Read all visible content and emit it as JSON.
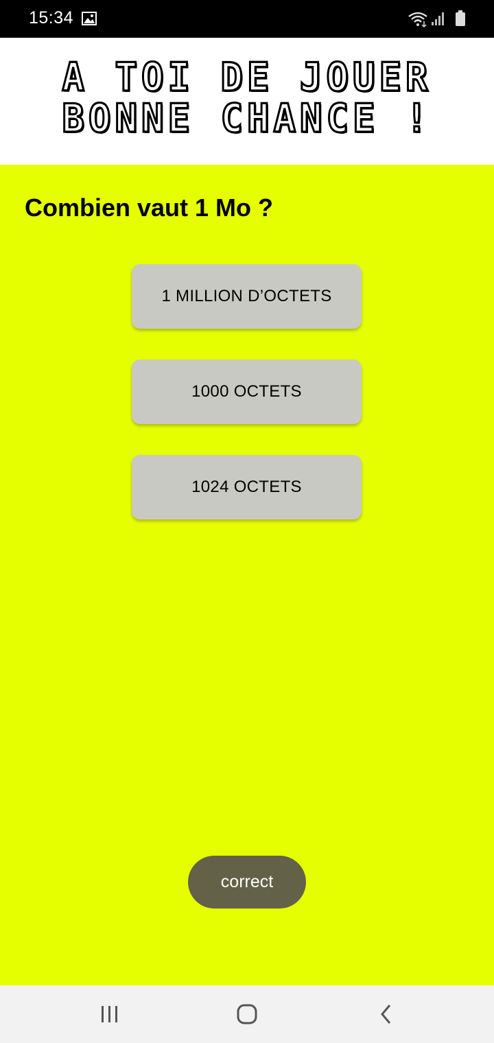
{
  "status_bar": {
    "time": "15:34",
    "icons": [
      "gallery-icon",
      "wifi-icon",
      "signal-icon",
      "battery-icon"
    ]
  },
  "banner": {
    "line1": "A TOI DE JOUER",
    "line2": "BONNE CHANCE !"
  },
  "quiz": {
    "question": "Combien vaut 1 Mo ?",
    "answers": [
      "1 MILLION D’OCTETS",
      "1000 OCTETS",
      "1024 OCTETS"
    ]
  },
  "toast": {
    "message": "correct"
  },
  "nav_bar": {
    "icons": [
      "recent-apps-icon",
      "home-icon",
      "back-icon"
    ]
  },
  "colors": {
    "background": "#e6ff00",
    "button": "#c9c9c3",
    "toast": "#636248",
    "status_bar": "#000000",
    "nav_bar": "#f2f2f2"
  }
}
